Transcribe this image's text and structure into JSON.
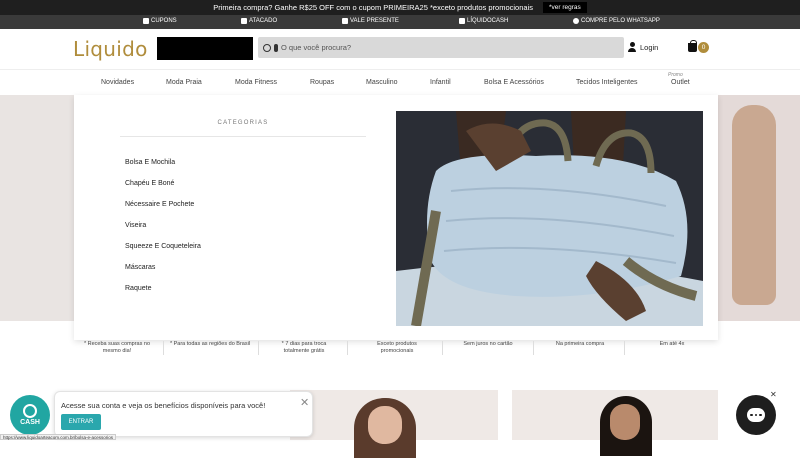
{
  "promo": {
    "text": "Primeira compra? Ganhe R$25 OFF com o cupom PRIMEIRA25 *exceto produtos promocionais",
    "rules_button": "*ver regras"
  },
  "top_links": [
    {
      "label": "CUPONS",
      "icon": "tag-icon"
    },
    {
      "label": "ATACADO",
      "icon": "store-icon"
    },
    {
      "label": "VALE PRESENTE",
      "icon": "gift-icon"
    },
    {
      "label": "LÍQUIDOCASH",
      "icon": "wallet-icon"
    },
    {
      "label": "COMPRE PELO WHATSAPP",
      "icon": "whatsapp-icon"
    }
  ],
  "header": {
    "logo": "Liquido",
    "search_placeholder": "O que você procura?",
    "login_label": "Login",
    "cart_count": "0"
  },
  "nav": {
    "items": [
      "Novidades",
      "Moda Praia",
      "Moda Fitness",
      "Roupas",
      "Masculino",
      "Infantil",
      "Bolsa E Acessórios",
      "Tecidos Inteligentes",
      "Outlet"
    ],
    "outlet_tag": "Promo"
  },
  "dropdown": {
    "title": "CATEGORIAS",
    "categories": [
      "Bolsa E Mochila",
      "Chapéu E Boné",
      "Nécessaire E Pochete",
      "Viseira",
      "Squeeze E Coqueteleira",
      "Máscaras",
      "Raquete"
    ]
  },
  "benefits": [
    "* Receba suas compras no mesmo dia!",
    "* Para todas as regiões do Brasil",
    "* 7 dias para troca totalmente grátis",
    "Exceto produtos promocionais",
    "Sem juros no cartão",
    "Na primeira compra",
    "Em até 4x"
  ],
  "toast": {
    "message": "Acesse sua conta e veja os benefícios disponíveis para você!",
    "button": "ENTRAR"
  },
  "cash_widget": {
    "label": "CASH"
  },
  "status_url": "https://www.liquidoarteacom.com.br/bolsa-e-acessorios",
  "colors": {
    "brand": "#b08d3c",
    "accent": "#2aa7ad",
    "topbar": "#1f1f1f"
  }
}
